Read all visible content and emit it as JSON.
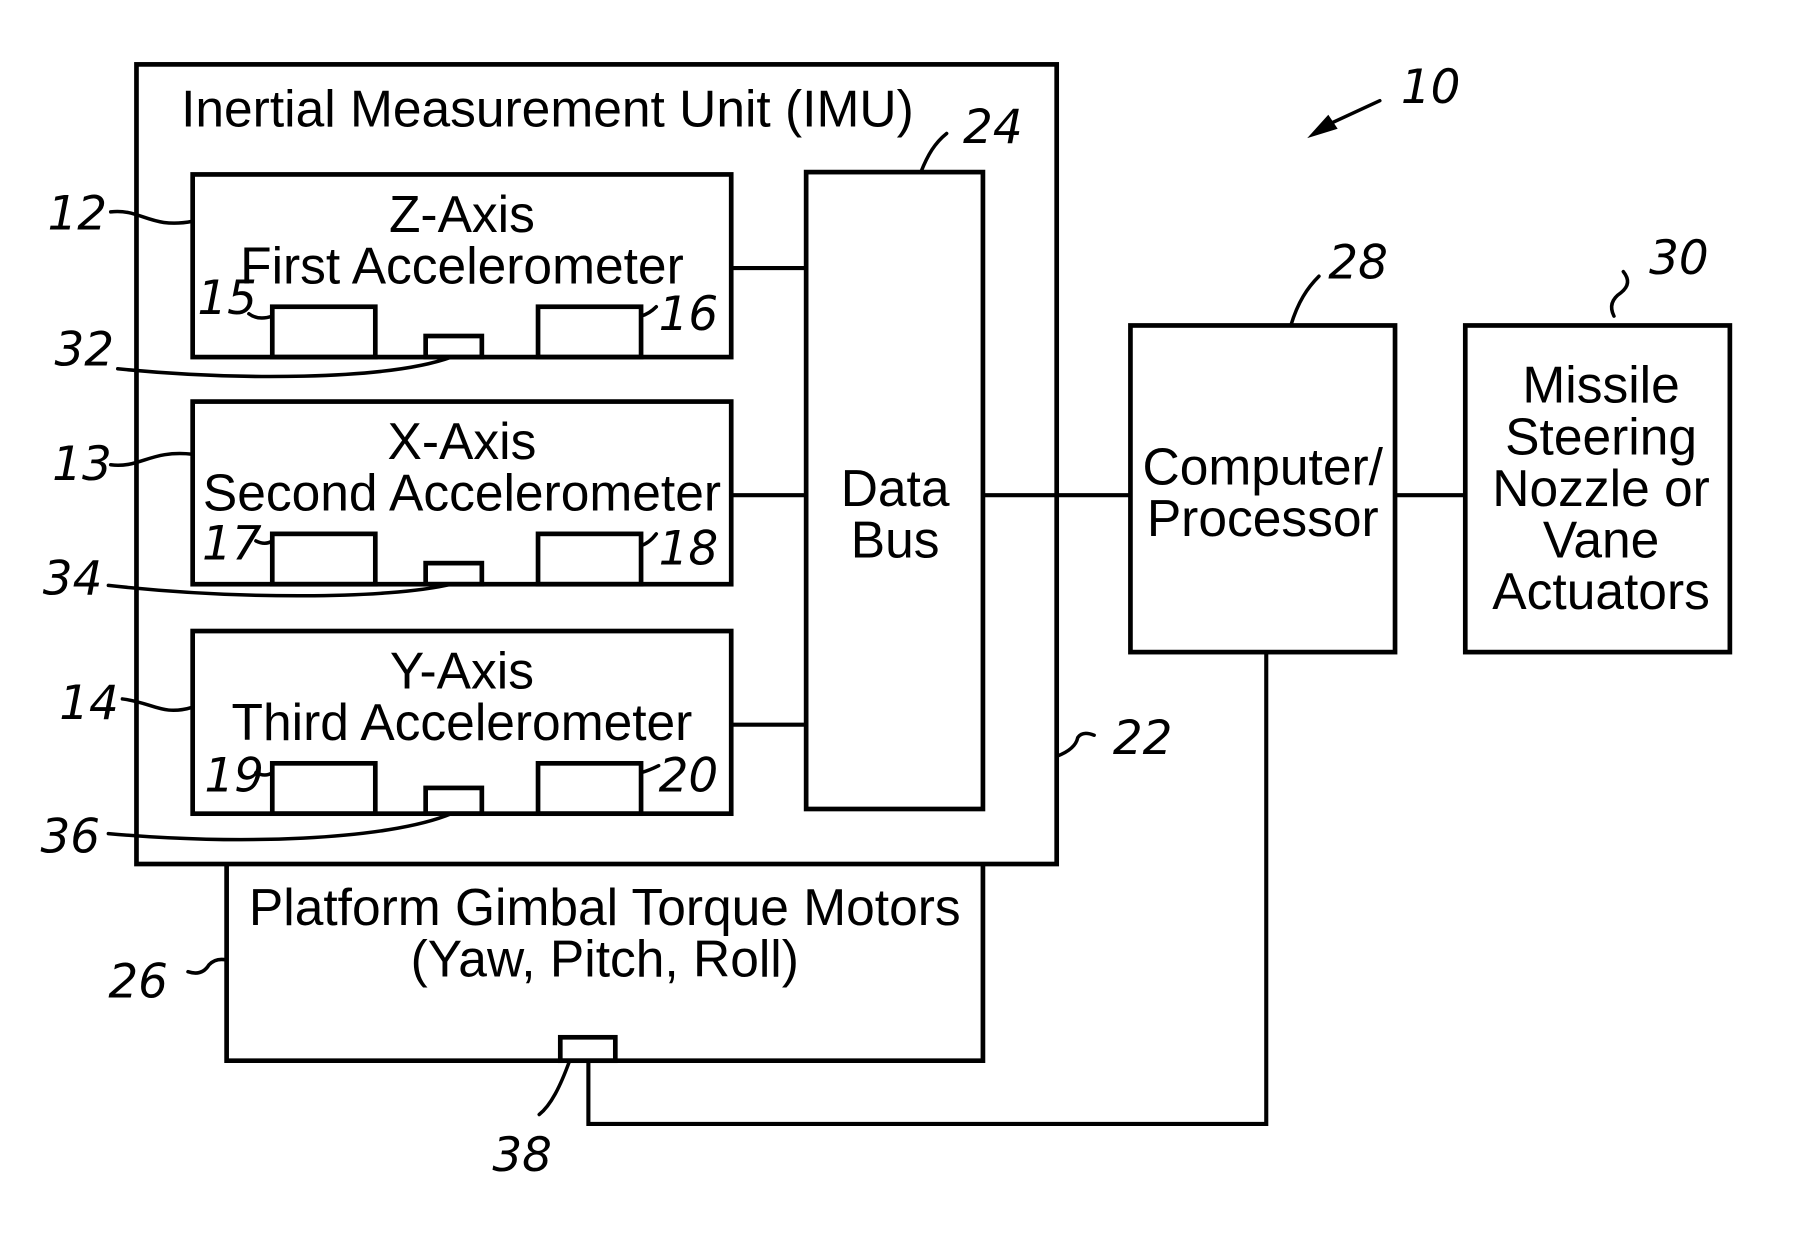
{
  "figure": {
    "reference": "10",
    "imu": {
      "title": "Inertial Measurement Unit (IMU)",
      "ref": "22"
    },
    "accelerometers": [
      {
        "axis": "Z-Axis",
        "name": "First Accelerometer",
        "ref": "12",
        "left_ref": "15",
        "right_ref": "16",
        "sensor_ref": "32"
      },
      {
        "axis": "X-Axis",
        "name": "Second Accelerometer",
        "ref": "13",
        "left_ref": "17",
        "right_ref": "18",
        "sensor_ref": "34"
      },
      {
        "axis": "Y-Axis",
        "name": "Third Accelerometer",
        "ref": "14",
        "left_ref": "19",
        "right_ref": "20",
        "sensor_ref": "36"
      }
    ],
    "data_bus": {
      "line1": "Data",
      "line2": "Bus",
      "ref": "24"
    },
    "computer": {
      "line1": "Computer/",
      "line2": "Processor",
      "ref": "28"
    },
    "actuators": {
      "lines": [
        "Missile",
        "Steering",
        "Nozzle or",
        "Vane",
        "Actuators"
      ],
      "ref": "30"
    },
    "gimbal": {
      "line1": "Platform Gimbal Torque Motors",
      "line2": "(Yaw, Pitch, Roll)",
      "ref": "26",
      "sensor_ref": "38"
    }
  }
}
